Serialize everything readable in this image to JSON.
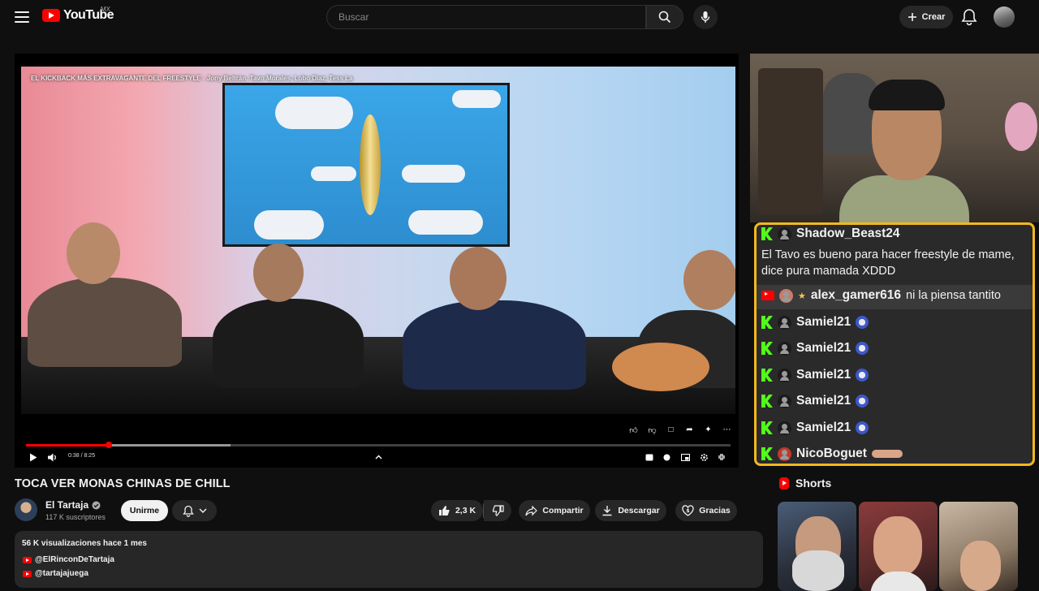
{
  "header": {
    "logo_text": "YouTube",
    "country_code": "MX",
    "search_placeholder": "Buscar",
    "create_label": "Crear"
  },
  "player": {
    "overlay_title": "EL KICKBACK MÁS EXTRAVAGANTE DEL FREESTYLE - Jony Beltrán, Tavo Morales, Lobo Díaz, Tess La",
    "time_display": "0:38 / 8:25",
    "progress_fraction": 0.118,
    "buffered_fraction": 0.29,
    "accent_color": "#ff0000"
  },
  "video": {
    "title": "TOCA VER MONAS CHINAS DE CHILL",
    "channel_name": "El Tartaja",
    "subscribers": "117 K suscriptores",
    "join_label": "Unirme",
    "likes": "2,3 K",
    "share_label": "Compartir",
    "download_label": "Descargar",
    "thanks_label": "Gracias"
  },
  "description": {
    "meta": "56 K visualizaciones  hace 1 mes",
    "links": [
      "@ElRinconDeTartaja",
      "@tartajajuega"
    ]
  },
  "chat": {
    "border_color": "#f2b81f",
    "first_user": "Shadow_Beast24",
    "first_message_line1": "El Tavo es bueno para hacer freestyle de mame,",
    "first_message_line2": "dice pura mamada XDDD",
    "yt_user": "alex_gamer616",
    "yt_message": "ni la piensa tantito",
    "repeat_user": "Samiel21",
    "last_user": "NicoBoguet"
  },
  "shorts": {
    "heading": "Shorts"
  },
  "icons": [
    "menu-icon",
    "search-icon",
    "mic-icon",
    "plus-icon",
    "bell-icon",
    "play-icon",
    "volume-icon",
    "chevron-up-icon",
    "settings-icon",
    "fullscreen-exit-icon",
    "like-icon",
    "dislike-icon",
    "share-icon",
    "download-icon",
    "heart-icon",
    "verified-icon",
    "kick-icon",
    "youtube-icon"
  ]
}
